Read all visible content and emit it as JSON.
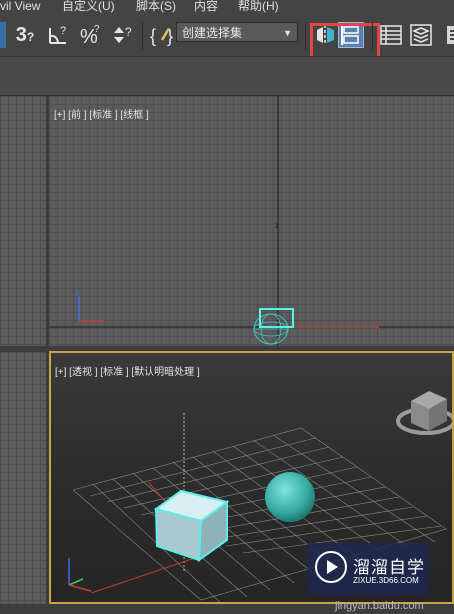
{
  "menubar": {
    "items": [
      "vil View",
      "自定义(U)",
      "脚本(S)",
      "内容",
      "帮助(H)"
    ]
  },
  "toolbar": {
    "selection_set": "创建选择集",
    "snap_label": "3",
    "icons": [
      "snap-3d-icon",
      "angle-snap-icon",
      "percent-snap-icon",
      "spinner-snap-icon",
      "named-selection-icon",
      "mirror-icon",
      "align-icon",
      "layer-explorer-icon",
      "scene-explorer-icon"
    ]
  },
  "viewport_front": {
    "label": "[+] [前 ] [标准 ] [线框 ]",
    "axis_z": "z",
    "axis_x": "x"
  },
  "viewport_persp": {
    "label": "[+] [透视 ] [标准 ] [默认明暗处理 ]"
  },
  "watermark": {
    "main": "溜溜自学",
    "sub": "ZIXUE.3D66.COM"
  },
  "footer": {
    "text": "jingyan.baidu.com"
  },
  "colors": {
    "highlight": "#e04848",
    "active_border": "#c8a34a",
    "object": "#5fd6cf"
  }
}
